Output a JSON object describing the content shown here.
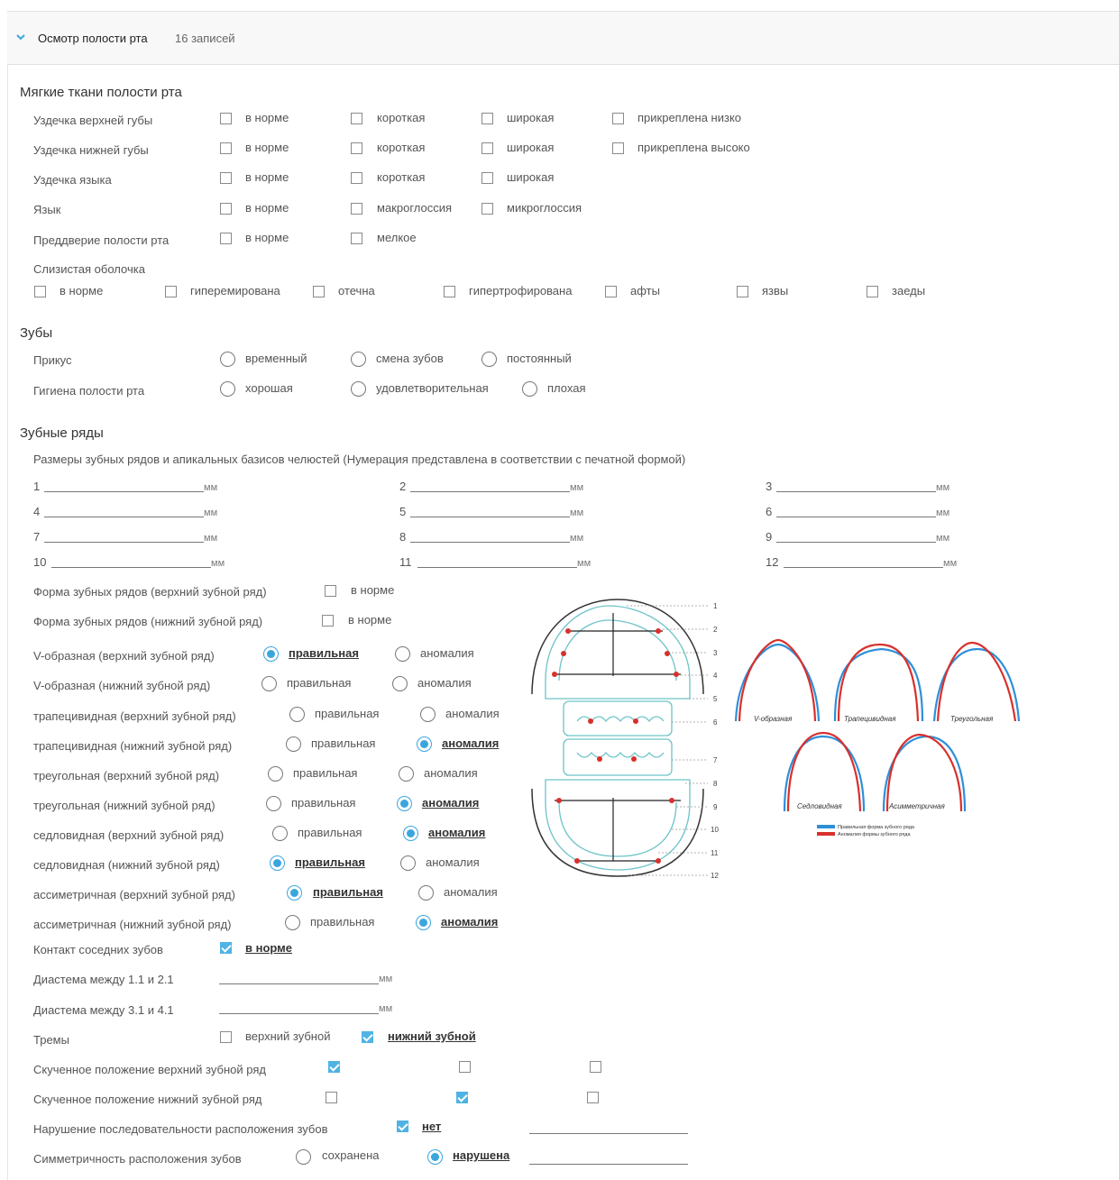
{
  "header": {
    "title": "Осмотр полости рта",
    "count": "16 записей"
  },
  "soft": {
    "title": "Мягкие ткани полости рта",
    "rows": [
      {
        "label": "Уздечка верхней губы",
        "opts": [
          "в норме",
          "короткая",
          "широкая",
          "прикреплена низко"
        ]
      },
      {
        "label": "Уздечка нижней губы",
        "opts": [
          "в норме",
          "короткая",
          "широкая",
          "прикреплена высоко"
        ]
      },
      {
        "label": "Уздечка языка",
        "opts": [
          "в норме",
          "короткая",
          "широкая"
        ]
      },
      {
        "label": "Язык",
        "opts": [
          "в норме",
          "макроглоссия",
          "микроглоссия"
        ]
      },
      {
        "label": "Преддверие полости рта",
        "opts": [
          "в норме",
          "мелкое"
        ]
      }
    ],
    "mucosa_label": "Слизистая оболочка",
    "mucosa_opts": [
      "в норме",
      "гиперемирована",
      "отечна",
      "гипертрофирована",
      "афты",
      "язвы",
      "заеды"
    ]
  },
  "teeth": {
    "title": "Зубы",
    "bite_label": "Прикус",
    "bite_opts": [
      "временный",
      "смена зубов",
      "постоянный"
    ],
    "hygiene_label": "Гигиена полости рта",
    "hygiene_opts": [
      "хорошая",
      "удовлетворительная",
      "плохая"
    ]
  },
  "rows": {
    "title": "Зубные ряды",
    "sizes_title": "Размеры зубных рядов и апикальных базисов челюстей (Нумерация представлена в соответствии с печатной формой)",
    "size_numbers": [
      "1",
      "2",
      "3",
      "4",
      "5",
      "6",
      "7",
      "8",
      "9",
      "10",
      "11",
      "12"
    ],
    "unit": "мм",
    "form_upper": "Форма зубных рядов (верхний зубной ряд)",
    "form_lower": "Форма зубных рядов (нижний зубной ряд)",
    "norm": "в норме",
    "correct": "правильная",
    "anomaly": "аномалия",
    "shapes": [
      {
        "label": "V-образная (верхний зубной ряд)",
        "selected": "correct"
      },
      {
        "label": "V-образная (нижний зубной ряд)",
        "selected": ""
      },
      {
        "label": "трапецивидная (верхний зубной ряд)",
        "selected": ""
      },
      {
        "label": "трапецивидная (нижний зубной ряд)",
        "selected": "anomaly"
      },
      {
        "label": "треугольная (верхний зубной ряд)",
        "selected": ""
      },
      {
        "label": "треугольная (нижний зубной ряд)",
        "selected": "anomaly"
      },
      {
        "label": "седловидная (верхний зубной ряд)",
        "selected": "anomaly"
      },
      {
        "label": "седловидная (нижний зубной ряд)",
        "selected": "correct"
      },
      {
        "label": "ассиметричная (верхний зубной ряд)",
        "selected": "correct"
      },
      {
        "label": "ассиметричная (нижний зубной ряд)",
        "selected": "anomaly"
      }
    ],
    "contact_label": "Контакт соседних зубов",
    "contact_value": "в норме",
    "diastema_upper": "Диастема между 1.1 и 2.1",
    "diastema_lower": "Диастема между 3.1 и 4.1",
    "tremy_label": "Тремы",
    "tremy_upper": "верхний зубной",
    "tremy_lower": "нижний зубной",
    "crowd_upper": "Скученное положение верхний зубной ряд",
    "crowd_lower": "Скученное положение нижний зубной ряд",
    "sequence_label": "Нарушение последовательности расположения зубов",
    "sequence_value": "нет",
    "symmetry_label": "Симметричность расположения зубов",
    "symmetry_opt1": "сохранена",
    "symmetry_opt2": "нарушена"
  },
  "diagram": {
    "numbers": [
      "1",
      "2",
      "3",
      "4",
      "5",
      "6",
      "7",
      "8",
      "9",
      "10",
      "11",
      "12"
    ],
    "shape_labels": [
      "V-образная",
      "Трапецивидная",
      "Треугольная",
      "Седловидная",
      "Асимметричная"
    ],
    "legend_normal": "Правильная форма зубного ряда",
    "legend_anomaly": "Аномалия формы зубного ряда",
    "color_normal": "#2f8fd8",
    "color_anomaly": "#d9302c"
  }
}
